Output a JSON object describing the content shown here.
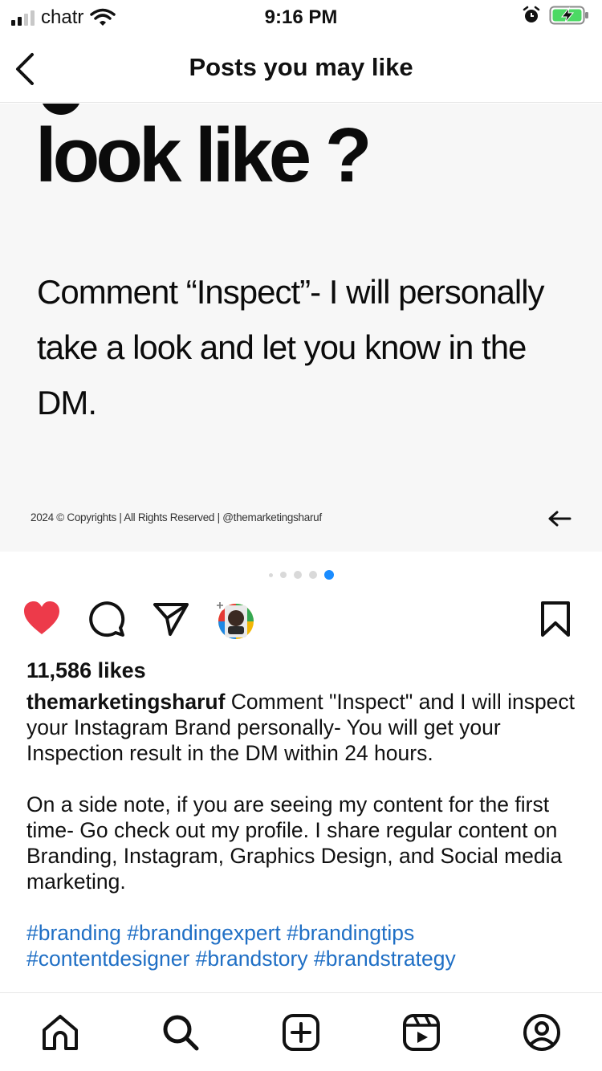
{
  "status_bar": {
    "carrier": "chatr",
    "time": "9:16 PM"
  },
  "header": {
    "title": "Posts you may like"
  },
  "post_image": {
    "headline": "look like ?",
    "body": "Comment “Inspect”- I will personally take a look and let you know in the DM.",
    "footer": "2024  ©  Copyrights  |  All Rights Reserved  |  @themarketingsharuf"
  },
  "carousel": {
    "count": 5,
    "active_index": 4
  },
  "post": {
    "likes": "11,586 likes",
    "username": "themarketingsharuf",
    "caption_text": "Comment \"Inspect\" and I will inspect your Instagram Brand personally- You will get your Inspection result in the DM within 24 hours.",
    "paragraph2": "On a side note, if you are seeing my content for the first time- Go check out my profile. I share regular content on Branding, Instagram, Graphics Design, and Social media marketing.",
    "hashtags_line1": "#branding #brandingexpert #brandingtips",
    "hashtags_line2": "#contentdesigner #brandstory #brandstrategy"
  },
  "colors": {
    "like_red": "#ed3a4a",
    "link_blue": "#1f6fc5",
    "dot_active": "#1a8cff",
    "battery_green": "#4cd964"
  },
  "icons": [
    "back-icon",
    "heart-icon",
    "comment-icon",
    "share-icon",
    "bookmark-icon",
    "home-icon",
    "search-icon",
    "create-icon",
    "reels-icon",
    "profile-icon"
  ]
}
